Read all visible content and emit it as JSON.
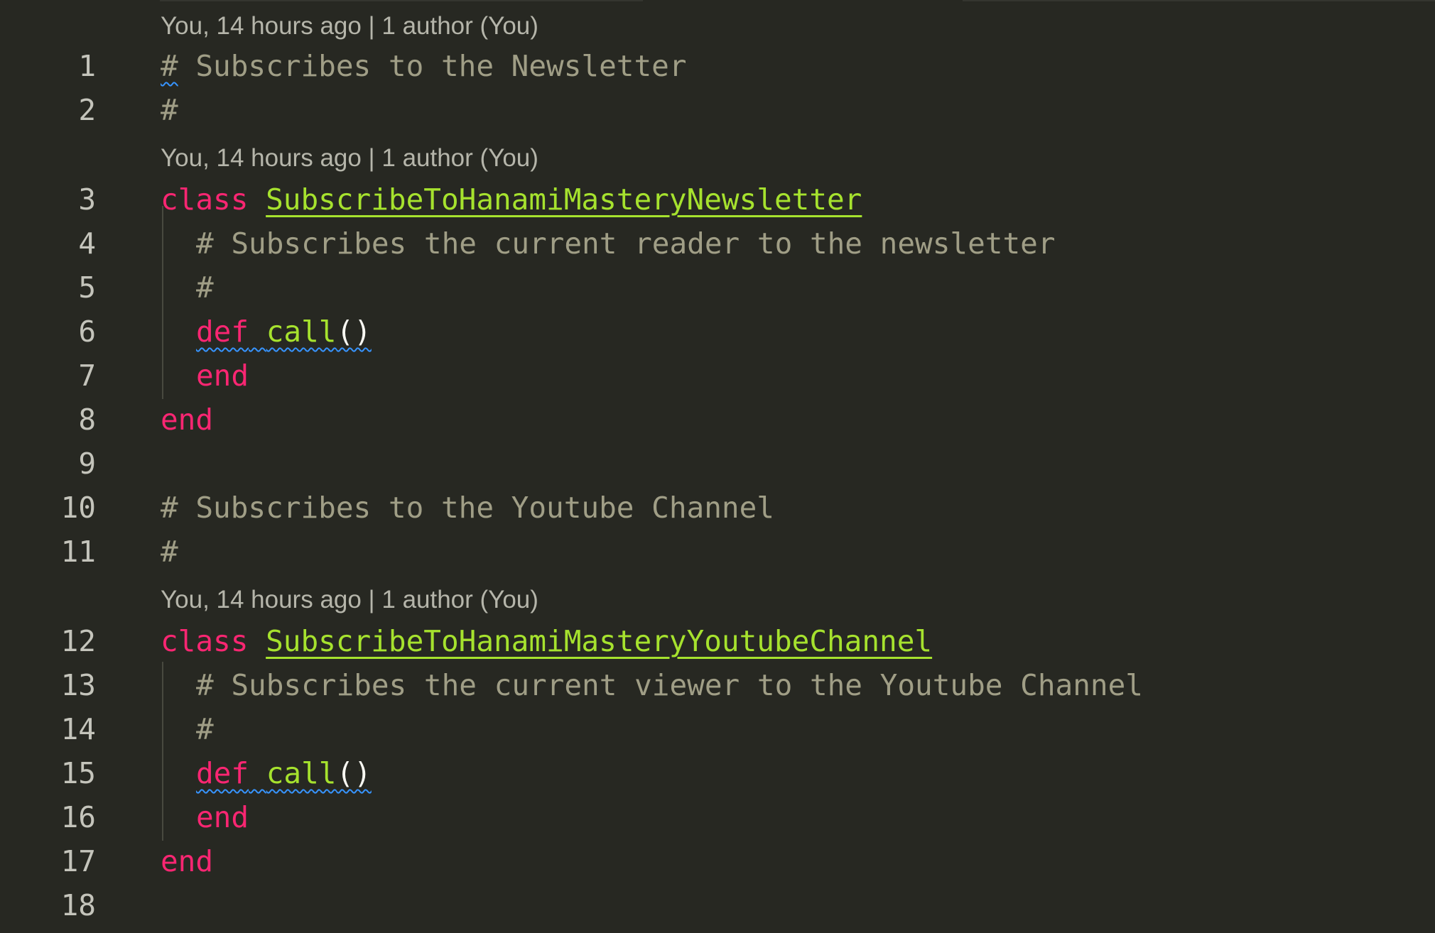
{
  "codelens": [
    "You, 14 hours ago | 1 author (You)",
    "You, 14 hours ago | 1 author (You)",
    "You, 14 hours ago | 1 author (You)"
  ],
  "lines": {
    "l1": {
      "num": "1",
      "hash": "#",
      "text": " Subscribes to the Newsletter"
    },
    "l2": {
      "num": "2",
      "hash": "#"
    },
    "l3": {
      "num": "3",
      "kw": "class",
      "name": "SubscribeToHanamiMasteryNewsletter"
    },
    "l4": {
      "num": "4",
      "text": "# Subscribes the current reader to the newsletter"
    },
    "l5": {
      "num": "5",
      "text": "#"
    },
    "l6": {
      "num": "6",
      "kw": "def",
      "fn": "call",
      "parens": "()"
    },
    "l7": {
      "num": "7",
      "kw": "end"
    },
    "l8": {
      "num": "8",
      "kw": "end"
    },
    "l9": {
      "num": "9"
    },
    "l10": {
      "num": "10",
      "text": "# Subscribes to the Youtube Channel"
    },
    "l11": {
      "num": "11",
      "text": "#"
    },
    "l12": {
      "num": "12",
      "kw": "class",
      "name": "SubscribeToHanamiMasteryYoutubeChannel"
    },
    "l13": {
      "num": "13",
      "text": "# Subscribes the current viewer to the Youtube Channel"
    },
    "l14": {
      "num": "14",
      "text": "#"
    },
    "l15": {
      "num": "15",
      "kw": "def",
      "fn": "call",
      "parens": "()"
    },
    "l16": {
      "num": "16",
      "kw": "end"
    },
    "l17": {
      "num": "17",
      "kw": "end"
    },
    "l18": {
      "num": "18"
    }
  },
  "colors": {
    "background": "#272822",
    "comment": "#a09e86",
    "keyword": "#f92672",
    "class_name": "#a6e22e",
    "function_name": "#a6e22e",
    "line_number": "#c4c4bb",
    "codelens": "#b5b5aa",
    "squiggle": "#3794ff"
  }
}
